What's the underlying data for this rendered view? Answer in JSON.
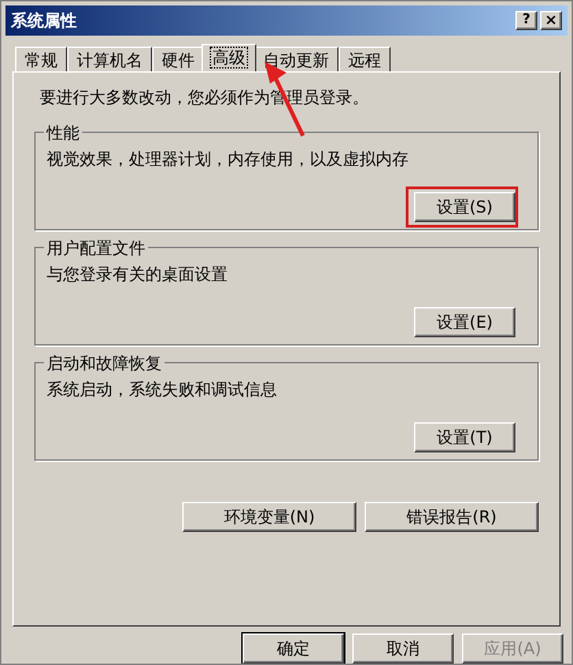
{
  "window": {
    "title": "系统属性",
    "help_button": "?",
    "close_button": "×"
  },
  "tabs": [
    {
      "label": "常规",
      "selected": false
    },
    {
      "label": "计算机名",
      "selected": false
    },
    {
      "label": "硬件",
      "selected": false
    },
    {
      "label": "高级",
      "selected": true
    },
    {
      "label": "自动更新",
      "selected": false
    },
    {
      "label": "远程",
      "selected": false
    }
  ],
  "notice": "要进行大多数改动，您必须作为管理员登录。",
  "groups": [
    {
      "title": "性能",
      "description": "视觉效果，处理器计划，内存使用，以及虚拟内存",
      "button": "设置(S)",
      "highlighted": true
    },
    {
      "title": "用户配置文件",
      "description": "与您登录有关的桌面设置",
      "button": "设置(E)",
      "highlighted": false
    },
    {
      "title": "启动和故障恢复",
      "description": "系统启动，系统失败和调试信息",
      "button": "设置(T)",
      "highlighted": false
    }
  ],
  "extra_buttons": [
    "环境变量(N)",
    "错误报告(R)"
  ],
  "dialog_buttons": [
    {
      "label": "确定",
      "disabled": false,
      "default": true
    },
    {
      "label": "取消",
      "disabled": false,
      "default": false
    },
    {
      "label": "应用(A)",
      "disabled": true,
      "default": false
    }
  ]
}
